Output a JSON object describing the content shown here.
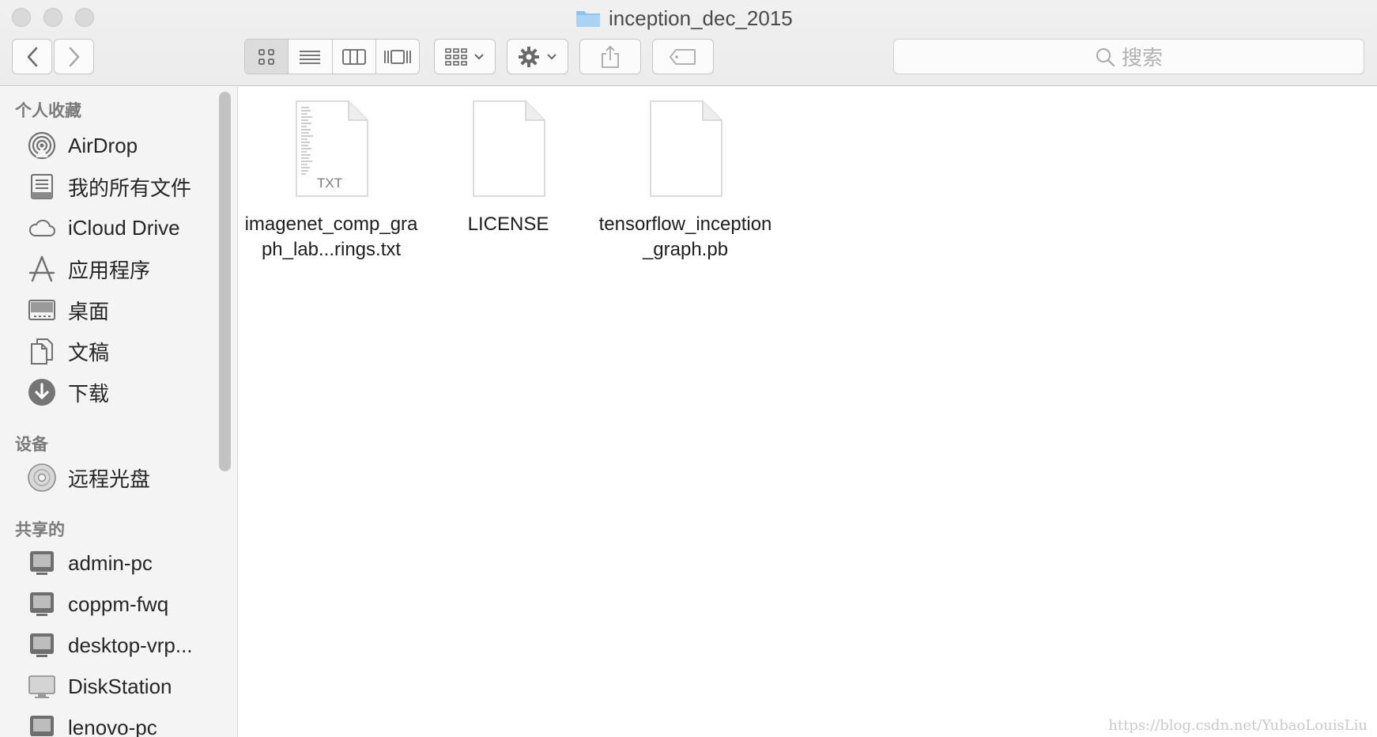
{
  "window": {
    "title": "inception_dec_2015"
  },
  "toolbar": {
    "back_icon": "chevron-left-icon",
    "forward_icon": "chevron-right-icon",
    "view_modes": [
      "icon-view",
      "list-view",
      "column-view",
      "cover-flow-view"
    ],
    "active_view": "icon-view",
    "search_placeholder": "搜索"
  },
  "sidebar": {
    "favorites": {
      "heading": "个人收藏",
      "items": [
        {
          "label": "AirDrop",
          "icon": "airdrop-icon"
        },
        {
          "label": "我的所有文件",
          "icon": "all-files-icon"
        },
        {
          "label": "iCloud Drive",
          "icon": "cloud-icon"
        },
        {
          "label": "应用程序",
          "icon": "applications-icon"
        },
        {
          "label": "桌面",
          "icon": "desktop-icon"
        },
        {
          "label": "文稿",
          "icon": "documents-icon"
        },
        {
          "label": "下载",
          "icon": "download-icon"
        }
      ]
    },
    "devices": {
      "heading": "设备",
      "items": [
        {
          "label": "远程光盘",
          "icon": "disc-icon"
        }
      ]
    },
    "shared": {
      "heading": "共享的",
      "items": [
        {
          "label": "admin-pc",
          "icon": "computer-icon"
        },
        {
          "label": "coppm-fwq",
          "icon": "computer-icon"
        },
        {
          "label": "desktop-vrp...",
          "icon": "computer-icon"
        },
        {
          "label": "DiskStation",
          "icon": "server-icon"
        },
        {
          "label": "lenovo-pc",
          "icon": "computer-icon"
        }
      ]
    }
  },
  "files": [
    {
      "name": "imagenet_comp_graph_lab...rings.txt",
      "badge": "TXT",
      "icon": "text-document-icon"
    },
    {
      "name": "LICENSE",
      "badge": "",
      "icon": "blank-document-icon"
    },
    {
      "name": "tensorflow_inception_graph.pb",
      "badge": "",
      "icon": "blank-document-icon"
    }
  ],
  "watermark": "https://blog.csdn.net/YubaoLouisLiu"
}
